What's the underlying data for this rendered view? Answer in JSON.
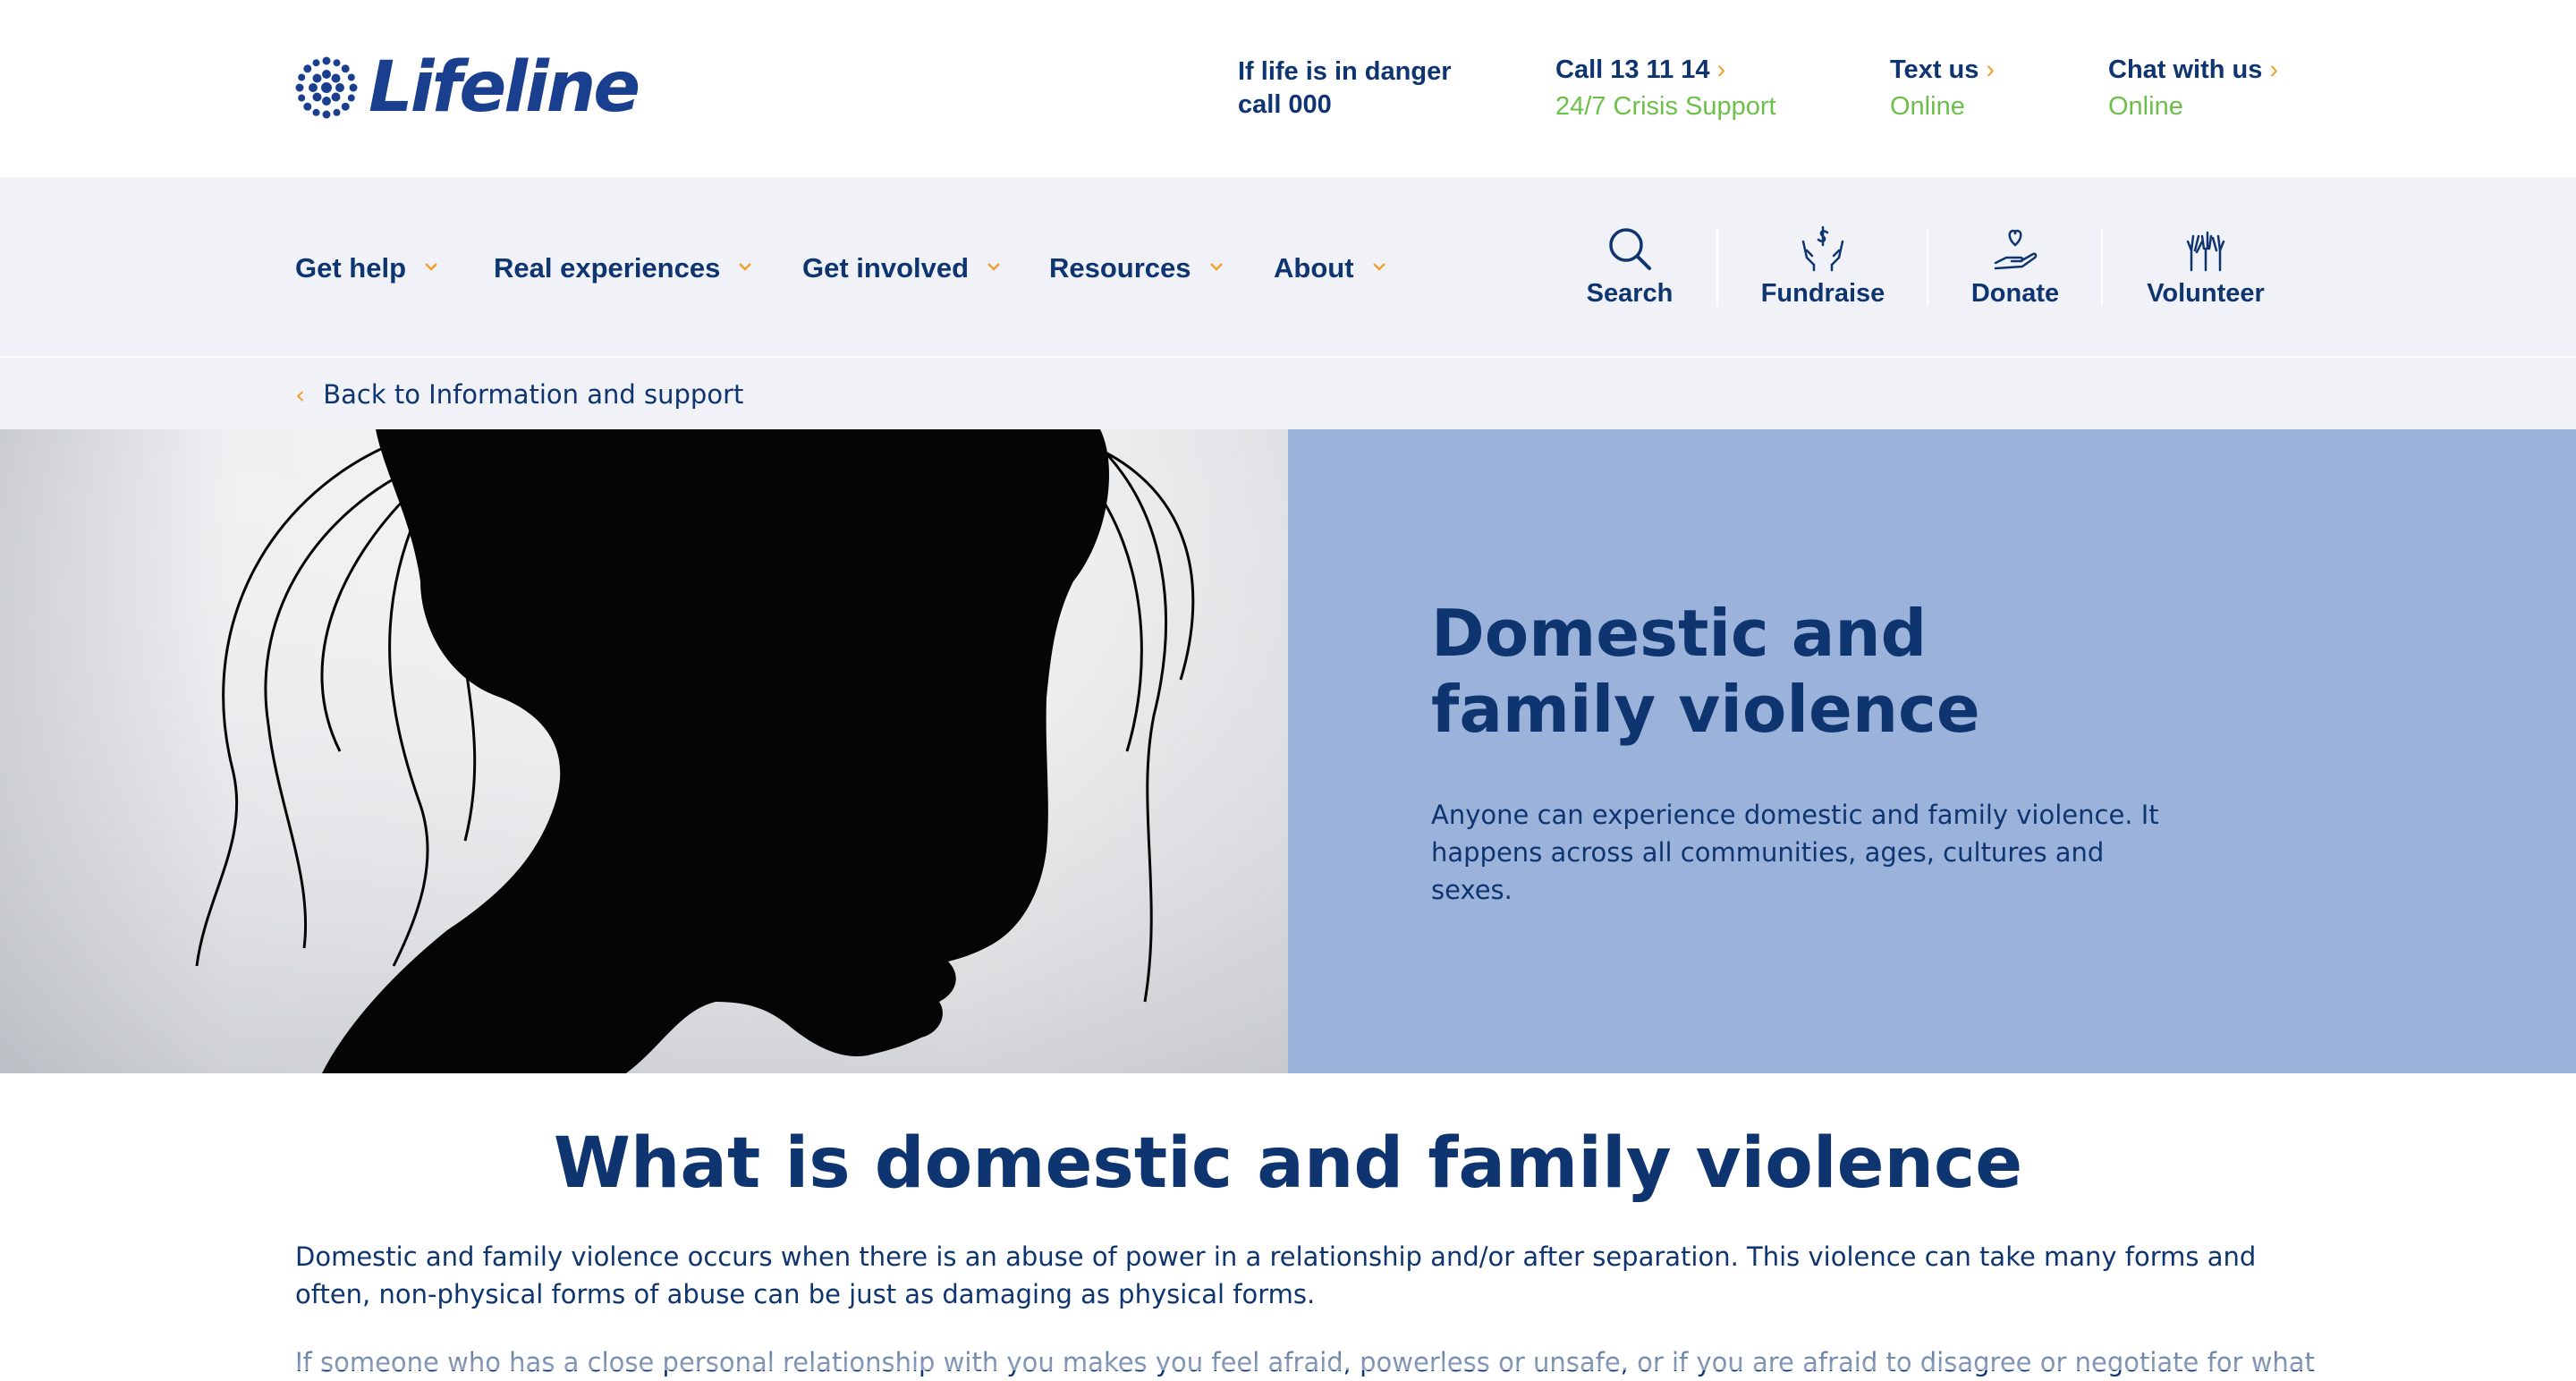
{
  "header": {
    "logo_text": "Lifeline",
    "danger_line1": "If life is in danger",
    "danger_line2": "call 000",
    "call": {
      "label": "Call 13 11 14",
      "sub": "24/7 Crisis Support"
    },
    "text": {
      "label": "Text us",
      "sub": "Online"
    },
    "chat": {
      "label": "Chat with us",
      "sub": "Online"
    }
  },
  "nav": {
    "items": [
      {
        "label": "Get help"
      },
      {
        "label": "Real experiences"
      },
      {
        "label": "Get involved"
      },
      {
        "label": "Resources"
      },
      {
        "label": "About"
      }
    ],
    "quick": [
      {
        "label": "Search",
        "icon": "search-icon"
      },
      {
        "label": "Fundraise",
        "icon": "fundraise-icon"
      },
      {
        "label": "Donate",
        "icon": "donate-icon"
      },
      {
        "label": "Volunteer",
        "icon": "volunteer-icon"
      }
    ]
  },
  "breadcrumb": {
    "back_label": "Back to Information and support"
  },
  "hero": {
    "title_line1": "Domestic and",
    "title_line2": "family violence",
    "description": "Anyone can experience domestic and family violence. It happens across all communities, ages, cultures and sexes."
  },
  "content": {
    "title": "What is domestic and family violence",
    "para1": "Domestic and family violence occurs when there is an abuse of power in a relationship and/or after separation. This violence can take many forms and often, non-physical forms of abuse can be just as damaging as physical forms.",
    "para2": "If someone who has a close personal relationship with you makes you feel afraid, powerless or unsafe, or if you are afraid to disagree or negotiate for what"
  },
  "colors": {
    "navy": "#0e3570",
    "green": "#6cc04a",
    "orange": "#f0a030",
    "hero_panel": "#9bb3db",
    "nav_bg": "#f0f2f8"
  }
}
